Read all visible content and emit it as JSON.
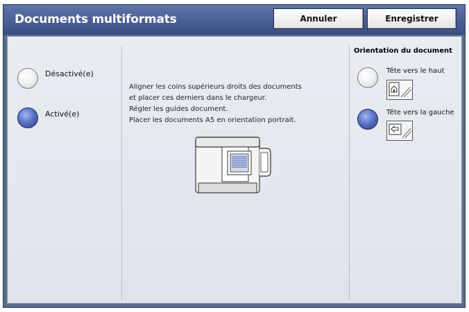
{
  "header": {
    "title": "Documents multiformats",
    "cancel_label": "Annuler",
    "save_label": "Enregistrer"
  },
  "mode": {
    "options": [
      {
        "label": "Désactivé(e)",
        "selected": false
      },
      {
        "label": "Activé(e)",
        "selected": true
      }
    ]
  },
  "instructions": {
    "lines": [
      "Aligner les coins supérieurs droits des documents",
      "et placer ces derniers dans le chargeur.",
      "Régler les guides document.",
      "Placer les documents A5 en orientation portrait."
    ]
  },
  "orientation": {
    "heading": "Orientation du document",
    "options": [
      {
        "label": "Tête vers le haut",
        "icon": "head-up-icon",
        "selected": false
      },
      {
        "label": "Tête vers la gauche",
        "icon": "head-left-icon",
        "selected": true
      }
    ]
  },
  "colors": {
    "titlebar": "#3a4e82",
    "frame": "#5b6c8c",
    "panel": "#e5e8ee",
    "radio_selected": "#3f56a8"
  }
}
